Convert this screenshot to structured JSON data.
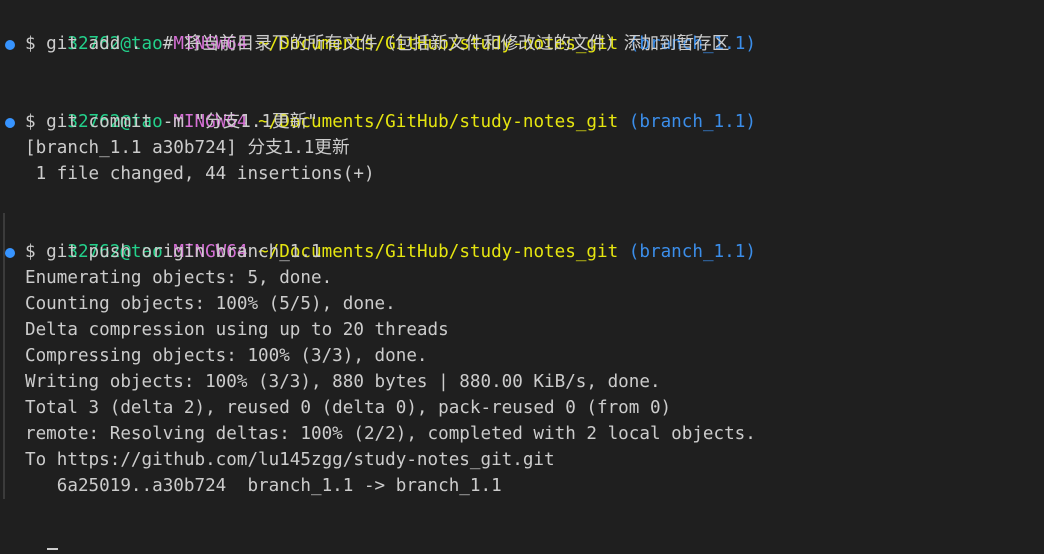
{
  "prompt": {
    "user_host": "32762@tao",
    "system": "MINGW64",
    "path": "~/Documents/GitHub/study-notes_git",
    "branch": "(branch_1.1)"
  },
  "colors": {
    "background": "#1f1f1f",
    "text": "#cccccc",
    "user_host": "#23d18b",
    "system": "#d670d6",
    "path": "#e5e510",
    "branch": "#3b8eea",
    "success_dot": "#3794ff"
  },
  "blocks": [
    {
      "command": "$ git add .  # 将当前目录下的所有文件（包括新文件和修改过的文件）添加到暂存区",
      "output": []
    },
    {
      "command": "$ git commit -m \"分支1.1更新\"",
      "output": [
        "[branch_1.1 a30b724] 分支1.1更新",
        " 1 file changed, 44 insertions(+)"
      ]
    },
    {
      "command": "$ git push origin branch_1.1",
      "output": [
        "Enumerating objects: 5, done.",
        "Counting objects: 100% (5/5), done.",
        "Delta compression using up to 20 threads",
        "Compressing objects: 100% (3/3), done.",
        "Writing objects: 100% (3/3), 880 bytes | 880.00 KiB/s, done.",
        "Total 3 (delta 2), reused 0 (delta 0), pack-reused 0 (from 0)",
        "remote: Resolving deltas: 100% (2/2), completed with 2 local objects.",
        "To https://github.com/lu145zgg/study-notes_git.git",
        "   6a25019..a30b724  branch_1.1 -> branch_1.1"
      ]
    }
  ]
}
